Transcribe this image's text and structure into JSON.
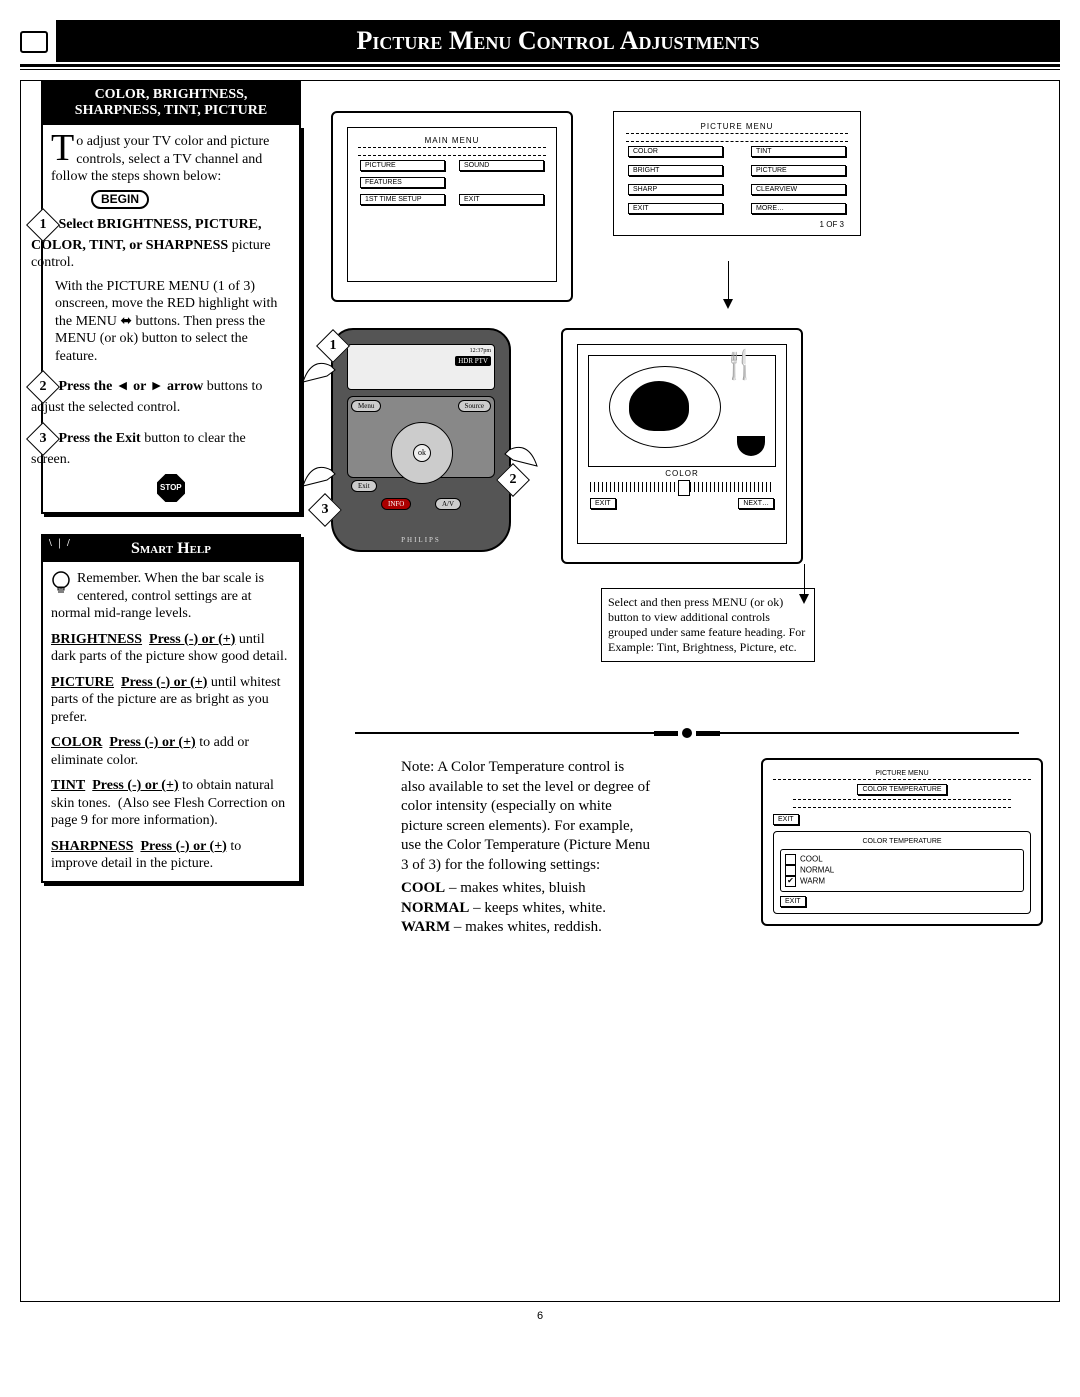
{
  "page_title": "Picture Menu Control Adjustments",
  "page_number": "6",
  "sidebar": {
    "heading_line1": "COLOR, BRIGHTNESS,",
    "heading_line2": "SHARPNESS, TINT, PICTURE",
    "intro_dropcap": "T",
    "intro_text": "o adjust your TV color and picture controls, select a TV channel and follow the steps shown below:",
    "begin": "BEGIN",
    "steps": [
      {
        "num": "1",
        "bold_lead": "Select BRIGHTNESS, PICTURE, COLOR, TINT, or SHARPNESS ",
        "bold_tail": "picture control.",
        "detail": "With the PICTURE MENU (1 of 3) onscreen, move the RED highlight with the MENU ⬌ buttons. Then press the MENU (or ok) button to select the feature."
      },
      {
        "num": "2",
        "bold_lead": "Press the ◄ or ► arrow ",
        "bold_tail": "buttons to adjust the selected control.",
        "detail": ""
      },
      {
        "num": "3",
        "bold_lead": "Press the Exit ",
        "bold_tail": "button to clear the screen.",
        "detail": ""
      }
    ],
    "stop": "STOP"
  },
  "smarthelp": {
    "title": "Smart Help",
    "intro": "Remember. When the bar scale is centered, control settings are at normal mid-range levels.",
    "items": [
      {
        "name": "BRIGHTNESS",
        "rest": "Press (-) or (+) until dark parts of the picture show good detail."
      },
      {
        "name": "PICTURE",
        "rest": "Press (-) or (+) until whitest parts of the picture are as bright as you prefer."
      },
      {
        "name": "COLOR",
        "rest": "Press (-) or (+) to add or eliminate color."
      },
      {
        "name": "TINT",
        "rest": "Press (-) or (+) to obtain natural skin tones.  (Also see Flesh Correction on page 9 for more information)."
      },
      {
        "name": "SHARPNESS",
        "rest": "Press (-) or (+) to improve detail in the picture."
      }
    ]
  },
  "main_menu": {
    "label": "MAIN MENU",
    "items": [
      "PICTURE",
      "SOUND",
      "FEATURES",
      "1ST TIME SETUP",
      "EXIT"
    ]
  },
  "picture_menu": {
    "label": "PICTURE MENU",
    "left": [
      "COLOR",
      "BRIGHT",
      "SHARP",
      "EXIT"
    ],
    "right": [
      "TINT",
      "PICTURE",
      "CLEARVIEW",
      "MORE…"
    ],
    "page": "1 OF 3"
  },
  "color_adjust": {
    "label": "COLOR",
    "left_btn": "EXIT",
    "right_btn": "NEXT…"
  },
  "callout": "Select and then press MENU (or ok) button to view additional controls grouped under same feature heading. For Example: Tint, Brightness, Picture, etc.",
  "remote": {
    "time": "12:37pm",
    "brand_line": "HDR PTV",
    "menu_btn": "Menu",
    "source_btn": "Source",
    "exit_btn": "Exit",
    "info_btn": "INFO",
    "av_btn": "A/V",
    "logo": "PHILIPS",
    "markers": [
      "1",
      "2",
      "3"
    ]
  },
  "note": {
    "lead": "Note: A Color Temperature control is also available to set the level or degree of color intensity (especially on white picture screen elements). For example, use the Color Temperature (Picture Menu 3 of 3) for the following settings:",
    "settings": [
      {
        "name": "COOL",
        "desc": " – makes whites, bluish"
      },
      {
        "name": "NORMAL",
        "desc": " – keeps whites, white."
      },
      {
        "name": "WARM",
        "desc": " – makes whites, reddish."
      }
    ]
  },
  "temp_menu": {
    "label1": "PICTURE MENU",
    "item1": "COLOR TEMPERATURE",
    "exit": "EXIT",
    "label2": "COLOR TEMPERATURE",
    "options": [
      "COOL",
      "NORMAL",
      "WARM"
    ],
    "exit2": "EXIT"
  }
}
